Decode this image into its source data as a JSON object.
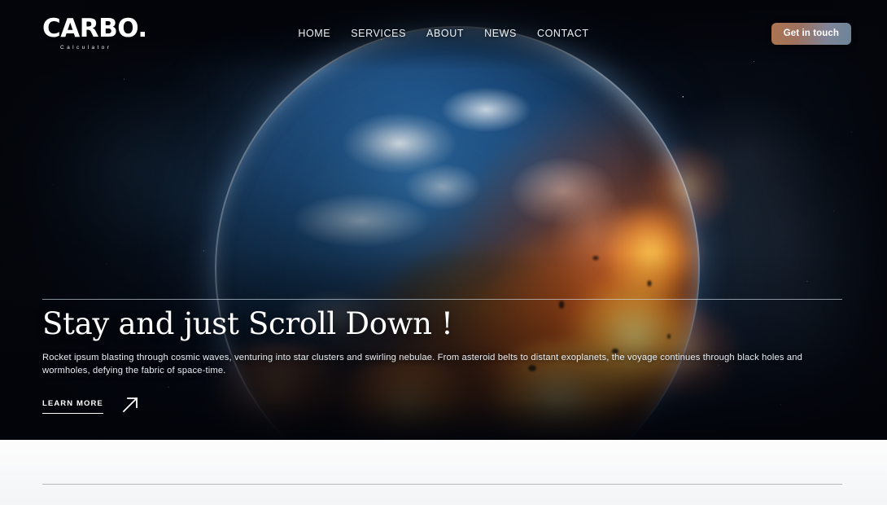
{
  "header": {
    "logo": {
      "main": "CARBO.",
      "sub": "Calculator"
    },
    "nav": [
      {
        "label": "HOME"
      },
      {
        "label": "SERVICES"
      },
      {
        "label": "ABOUT"
      },
      {
        "label": "NEWS"
      },
      {
        "label": "CONTACT"
      }
    ],
    "cta_label": "Get in touch"
  },
  "hero": {
    "headline": "Stay and just Scroll Down !",
    "subtext": "Rocket ipsum blasting through cosmic waves, venturing into star clusters and swirling nebulae. From asteroid belts to distant exoplanets, the voyage continues through black holes and wormholes, defying the fabric of space-time.",
    "learn_more_label": "LEARN MORE",
    "arrow_icon": "arrow-up-right-icon",
    "background_image": "earth-on-fire-from-space"
  },
  "colors": {
    "space_dark": "#05070c",
    "ocean_blue": "#1d4e80",
    "fire_orange": "#e87a1e",
    "cta_gradient_start": "#ad7450",
    "cta_gradient_end": "#6d8498",
    "hero_rule": "#d6e2ee",
    "section_divider": "#b6b8ba",
    "section_background": "#f7f8f9",
    "text_white": "#ffffff"
  }
}
